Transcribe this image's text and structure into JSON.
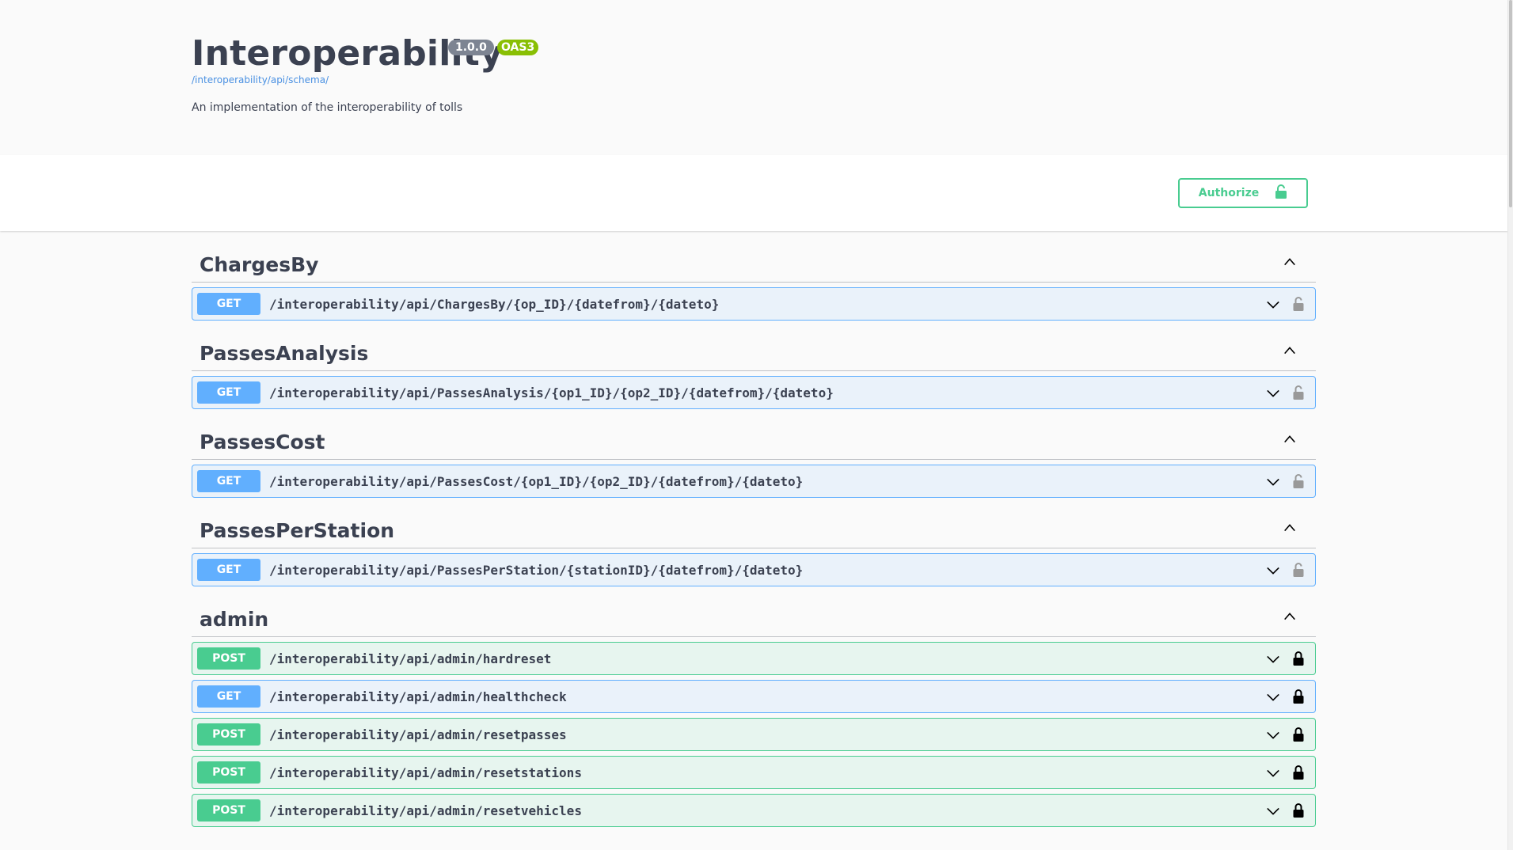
{
  "info": {
    "title": "Interoperability",
    "version": "1.0.0",
    "oas": "OAS3",
    "schema_link": "/interoperability/api/schema/",
    "description": "An implementation of the interoperability of tolls"
  },
  "authorize": {
    "label": "Authorize"
  },
  "colors": {
    "get": "#61affe",
    "post": "#49cc90",
    "version_badge": "#7d8492",
    "oas_badge": "#89bf04",
    "link": "#4990e2"
  },
  "sections": [
    {
      "name": "ChargesBy",
      "operations": [
        {
          "method": "GET",
          "path": "/interoperability/api/ChargesBy/{op_ID}/{datefrom}/{dateto}",
          "locked": false
        }
      ]
    },
    {
      "name": "PassesAnalysis",
      "operations": [
        {
          "method": "GET",
          "path": "/interoperability/api/PassesAnalysis/{op1_ID}/{op2_ID}/{datefrom}/{dateto}",
          "locked": false
        }
      ]
    },
    {
      "name": "PassesCost",
      "operations": [
        {
          "method": "GET",
          "path": "/interoperability/api/PassesCost/{op1_ID}/{op2_ID}/{datefrom}/{dateto}",
          "locked": false
        }
      ]
    },
    {
      "name": "PassesPerStation",
      "operations": [
        {
          "method": "GET",
          "path": "/interoperability/api/PassesPerStation/{stationID}/{datefrom}/{dateto}",
          "locked": false
        }
      ]
    },
    {
      "name": "admin",
      "operations": [
        {
          "method": "POST",
          "path": "/interoperability/api/admin/hardreset",
          "locked": true
        },
        {
          "method": "GET",
          "path": "/interoperability/api/admin/healthcheck",
          "locked": true
        },
        {
          "method": "POST",
          "path": "/interoperability/api/admin/resetpasses",
          "locked": true
        },
        {
          "method": "POST",
          "path": "/interoperability/api/admin/resetstations",
          "locked": true
        },
        {
          "method": "POST",
          "path": "/interoperability/api/admin/resetvehicles",
          "locked": true
        }
      ]
    }
  ]
}
